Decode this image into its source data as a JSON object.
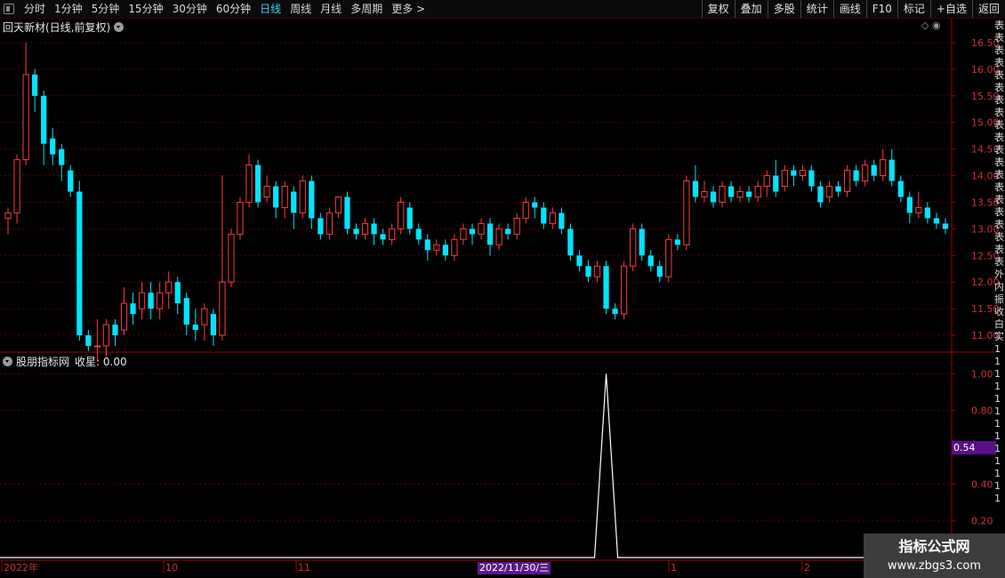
{
  "toolbar": {
    "periods": [
      "分时",
      "1分钟",
      "5分钟",
      "15分钟",
      "30分钟",
      "60分钟",
      "日线",
      "周线",
      "月线",
      "多周期",
      "更多 >"
    ],
    "active_period": "日线",
    "tools": [
      "复权",
      "叠加",
      "多股",
      "统计",
      "画线",
      "F10",
      "标记",
      "+自选",
      "返回"
    ]
  },
  "stock": {
    "title": "回天新材(日线,前复权)"
  },
  "indicator": {
    "name": "股朋指标网",
    "value_label": "收星: 0.00",
    "current_value": "0.54"
  },
  "price_axis": {
    "labels": [
      "16.50",
      "16.00",
      "15.50",
      "15.00",
      "14.50",
      "14.00",
      "13.50",
      "13.00",
      "12.50",
      "12.00",
      "11.50",
      "11.00"
    ]
  },
  "indicator_axis": {
    "labels": [
      "1.00",
      "0.80",
      "0.40",
      "0.20"
    ]
  },
  "time_axis": {
    "labels": [
      "2022年",
      "10",
      "11",
      "1",
      "2"
    ],
    "cursor_date": "2022/11/30/三"
  },
  "watermark": {
    "line1": "指标公式网",
    "line2": "www.zbgs3.com"
  },
  "colors": {
    "up": "#ff3b3b",
    "down": "#00e5ff",
    "grid": "#5a0000",
    "axis": "#aa0000",
    "active": "#35d0ff"
  },
  "right_strip": {
    "chars": [
      "表",
      "表",
      "表",
      "表",
      "表",
      "表",
      "表",
      "表",
      "表",
      "表",
      "表",
      "表",
      "表",
      "表",
      "表",
      "表",
      "表",
      "表",
      "表",
      "表",
      "外",
      "内",
      "振",
      "收",
      "白",
      "实",
      "1",
      "1",
      "1",
      "1",
      "1",
      "1",
      "1",
      "1",
      "1",
      "1",
      "1",
      "1",
      "1"
    ]
  },
  "chart_data": {
    "type": "candlestick",
    "ylim": [
      10.75,
      16.7
    ],
    "indicator_ylim": [
      0,
      1.05
    ],
    "candles": [
      [
        13.2,
        13.3,
        12.9,
        13.4
      ],
      [
        13.3,
        14.3,
        13.1,
        14.4
      ],
      [
        14.3,
        15.9,
        14.2,
        16.5
      ],
      [
        15.9,
        15.5,
        15.2,
        16.0
      ],
      [
        15.5,
        14.6,
        14.2,
        15.6
      ],
      [
        14.7,
        14.4,
        14.2,
        14.9
      ],
      [
        14.5,
        14.2,
        13.9,
        14.6
      ],
      [
        14.1,
        13.7,
        13.6,
        14.2
      ],
      [
        13.7,
        11.0,
        10.9,
        13.9
      ],
      [
        11.0,
        10.8,
        10.7,
        11.1
      ],
      [
        10.8,
        10.8,
        10.5,
        11.3
      ],
      [
        10.8,
        11.2,
        10.6,
        11.3
      ],
      [
        11.2,
        11.0,
        10.8,
        11.3
      ],
      [
        11.1,
        11.6,
        11.0,
        11.9
      ],
      [
        11.6,
        11.4,
        11.2,
        11.8
      ],
      [
        11.5,
        11.8,
        11.3,
        12.0
      ],
      [
        11.8,
        11.5,
        11.3,
        12.0
      ],
      [
        11.5,
        11.8,
        11.3,
        12.0
      ],
      [
        11.8,
        12.0,
        11.5,
        12.2
      ],
      [
        12.0,
        11.6,
        11.4,
        12.1
      ],
      [
        11.7,
        11.2,
        11.0,
        11.8
      ],
      [
        11.2,
        11.1,
        10.9,
        11.5
      ],
      [
        11.2,
        11.5,
        10.9,
        11.6
      ],
      [
        11.4,
        11.0,
        10.8,
        11.5
      ],
      [
        11.0,
        12.0,
        10.9,
        14.0
      ],
      [
        12.0,
        12.9,
        11.9,
        13.0
      ],
      [
        12.9,
        13.5,
        12.8,
        13.6
      ],
      [
        13.5,
        14.2,
        13.4,
        14.4
      ],
      [
        14.2,
        13.5,
        13.4,
        14.3
      ],
      [
        13.6,
        13.8,
        13.5,
        14.0
      ],
      [
        13.8,
        13.4,
        13.2,
        13.9
      ],
      [
        13.4,
        13.8,
        13.2,
        13.9
      ],
      [
        13.7,
        13.3,
        13.0,
        13.8
      ],
      [
        13.3,
        13.9,
        13.2,
        14.0
      ],
      [
        13.9,
        13.2,
        13.0,
        14.0
      ],
      [
        13.2,
        12.9,
        12.8,
        13.3
      ],
      [
        12.9,
        13.3,
        12.8,
        13.4
      ],
      [
        13.3,
        13.6,
        13.2,
        13.6
      ],
      [
        13.6,
        13.0,
        12.9,
        13.7
      ],
      [
        13.0,
        12.9,
        12.8,
        13.1
      ],
      [
        12.9,
        13.1,
        12.8,
        13.2
      ],
      [
        13.1,
        12.9,
        12.7,
        13.2
      ],
      [
        12.9,
        12.8,
        12.7,
        13.0
      ],
      [
        12.8,
        13.0,
        12.7,
        13.1
      ],
      [
        13.0,
        13.5,
        12.9,
        13.6
      ],
      [
        13.4,
        13.0,
        12.9,
        13.5
      ],
      [
        13.0,
        12.8,
        12.7,
        13.1
      ],
      [
        12.8,
        12.6,
        12.4,
        12.9
      ],
      [
        12.6,
        12.7,
        12.5,
        12.8
      ],
      [
        12.7,
        12.5,
        12.4,
        12.8
      ],
      [
        12.5,
        12.8,
        12.4,
        12.9
      ],
      [
        12.8,
        13.0,
        12.7,
        13.1
      ],
      [
        13.0,
        12.9,
        12.7,
        13.1
      ],
      [
        12.9,
        13.1,
        12.8,
        13.2
      ],
      [
        13.1,
        12.7,
        12.5,
        13.2
      ],
      [
        12.7,
        13.0,
        12.6,
        13.1
      ],
      [
        13.0,
        12.9,
        12.8,
        13.1
      ],
      [
        12.9,
        13.2,
        12.8,
        13.3
      ],
      [
        13.2,
        13.5,
        13.1,
        13.6
      ],
      [
        13.5,
        13.4,
        13.2,
        13.6
      ],
      [
        13.4,
        13.1,
        13.0,
        13.5
      ],
      [
        13.1,
        13.3,
        13.0,
        13.4
      ],
      [
        13.3,
        13.0,
        12.9,
        13.4
      ],
      [
        13.0,
        12.5,
        12.4,
        13.1
      ],
      [
        12.5,
        12.3,
        12.2,
        12.6
      ],
      [
        12.3,
        12.1,
        12.0,
        12.4
      ],
      [
        12.1,
        12.3,
        12.0,
        12.4
      ],
      [
        12.3,
        11.5,
        11.4,
        12.4
      ],
      [
        11.5,
        11.4,
        11.3,
        11.6
      ],
      [
        11.4,
        12.3,
        11.3,
        12.4
      ],
      [
        12.3,
        13.0,
        12.2,
        13.1
      ],
      [
        13.0,
        12.5,
        12.4,
        13.1
      ],
      [
        12.5,
        12.3,
        12.2,
        12.6
      ],
      [
        12.3,
        12.1,
        12.0,
        12.4
      ],
      [
        12.1,
        12.8,
        12.0,
        12.9
      ],
      [
        12.8,
        12.7,
        12.6,
        12.9
      ],
      [
        12.7,
        13.9,
        12.6,
        14.0
      ],
      [
        13.9,
        13.6,
        13.5,
        14.2
      ],
      [
        13.6,
        13.7,
        13.5,
        13.9
      ],
      [
        13.7,
        13.5,
        13.4,
        13.8
      ],
      [
        13.5,
        13.8,
        13.4,
        13.9
      ],
      [
        13.8,
        13.6,
        13.5,
        13.9
      ],
      [
        13.6,
        13.7,
        13.5,
        13.8
      ],
      [
        13.7,
        13.6,
        13.5,
        13.8
      ],
      [
        13.6,
        13.8,
        13.5,
        13.9
      ],
      [
        13.8,
        14.0,
        13.6,
        14.1
      ],
      [
        14.0,
        13.7,
        13.6,
        14.3
      ],
      [
        13.8,
        14.1,
        13.7,
        14.2
      ],
      [
        14.1,
        14.0,
        13.8,
        14.2
      ],
      [
        14.0,
        14.1,
        13.9,
        14.2
      ],
      [
        14.1,
        13.8,
        13.7,
        14.2
      ],
      [
        13.8,
        13.5,
        13.4,
        13.9
      ],
      [
        13.6,
        13.8,
        13.5,
        13.9
      ],
      [
        13.8,
        13.7,
        13.6,
        13.9
      ],
      [
        13.7,
        14.1,
        13.6,
        14.2
      ],
      [
        14.1,
        13.9,
        13.8,
        14.2
      ],
      [
        13.9,
        14.2,
        13.8,
        14.3
      ],
      [
        14.2,
        14.0,
        13.9,
        14.3
      ],
      [
        14.0,
        14.3,
        13.9,
        14.5
      ],
      [
        14.3,
        13.9,
        13.8,
        14.5
      ],
      [
        13.9,
        13.6,
        13.5,
        14.0
      ],
      [
        13.6,
        13.3,
        13.1,
        13.7
      ],
      [
        13.3,
        13.4,
        13.2,
        13.7
      ],
      [
        13.4,
        13.2,
        13.1,
        13.5
      ],
      [
        13.2,
        13.1,
        13.0,
        13.3
      ],
      [
        13.1,
        13.0,
        12.9,
        13.2
      ]
    ],
    "indicator_spike": {
      "index": 67,
      "value": 1.0
    }
  }
}
